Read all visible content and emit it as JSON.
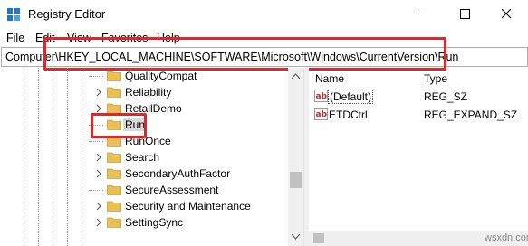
{
  "window": {
    "title": "Registry Editor",
    "controls": [
      "minimize-icon",
      "maximize-icon",
      "close-icon"
    ]
  },
  "menu": [
    {
      "label": "File"
    },
    {
      "label": "Edit"
    },
    {
      "label": "View"
    },
    {
      "label": "Favorites"
    },
    {
      "label": "Help"
    }
  ],
  "address": {
    "path": "Computer\\HKEY_LOCAL_MACHINE\\SOFTWARE\\Microsoft\\Windows\\CurrentVersion\\Run"
  },
  "tree": {
    "items": [
      {
        "label": "QualityCompat",
        "expandable": false,
        "selected": false
      },
      {
        "label": "Reliability",
        "expandable": true,
        "selected": false
      },
      {
        "label": "RetailDemo",
        "expandable": true,
        "selected": false
      },
      {
        "label": "Run",
        "expandable": false,
        "selected": true
      },
      {
        "label": "RunOnce",
        "expandable": false,
        "selected": false
      },
      {
        "label": "Search",
        "expandable": true,
        "selected": false
      },
      {
        "label": "SecondaryAuthFactor",
        "expandable": true,
        "selected": false
      },
      {
        "label": "SecureAssessment",
        "expandable": false,
        "selected": false
      },
      {
        "label": "Security and Maintenance",
        "expandable": true,
        "selected": false
      },
      {
        "label": "SettingSync",
        "expandable": true,
        "selected": false
      }
    ]
  },
  "values_pane": {
    "columns": [
      "Name",
      "Type"
    ],
    "rows": [
      {
        "name": "(Default)",
        "type": "REG_SZ",
        "icon": "string-value-icon"
      },
      {
        "name": "ETDCtrl",
        "type": "REG_EXPAND_SZ",
        "icon": "string-value-icon"
      }
    ]
  },
  "watermark": "wsxdn.com",
  "colors": {
    "highlight_box": "#e0262a",
    "folder": "#e8c05a",
    "selected_bg": "#d9d9d9"
  }
}
